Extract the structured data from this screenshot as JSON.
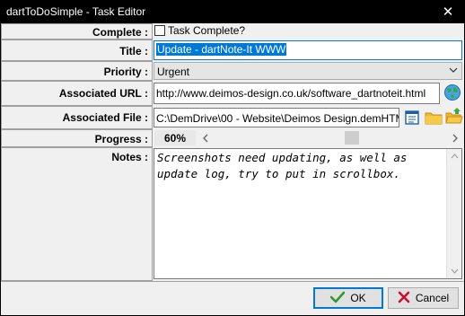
{
  "window": {
    "title": "dartToDoSimple - Task Editor",
    "close_glyph": "✕"
  },
  "fields": {
    "complete": {
      "label": "Complete :",
      "checkbox_text": "Task Complete?",
      "checked": false
    },
    "title": {
      "label": "Title :",
      "value": "Update - dartNote-It WWW"
    },
    "priority": {
      "label": "Priority :",
      "value": "Urgent"
    },
    "url": {
      "label": "Associated URL :",
      "value": "http://www.deimos-design.co.uk/software_dartnoteit.html"
    },
    "file": {
      "label": "Associated File :",
      "value": "C:\\DemDrive\\00 - Website\\Deimos Design.demHTM"
    },
    "progress": {
      "label": "Progress :",
      "value": "60%",
      "fraction": 0.6
    },
    "notes": {
      "label": "Notes :",
      "line1": "Screenshots need updating, as well as",
      "line2": "update log, try to put in scrollbox."
    }
  },
  "buttons": {
    "ok": "OK",
    "cancel": "Cancel"
  },
  "icons": {
    "globe": "globe-icon",
    "view_file": "file-view-icon",
    "folder": "folder-icon",
    "open_folder": "folder-open-icon",
    "check": "checkmark-icon",
    "cancel": "x-icon"
  },
  "colors": {
    "selection": "#0078d7",
    "titlebar": "#000000",
    "ok_check": "#2e9b2e",
    "cancel_x": "#c8102e"
  }
}
